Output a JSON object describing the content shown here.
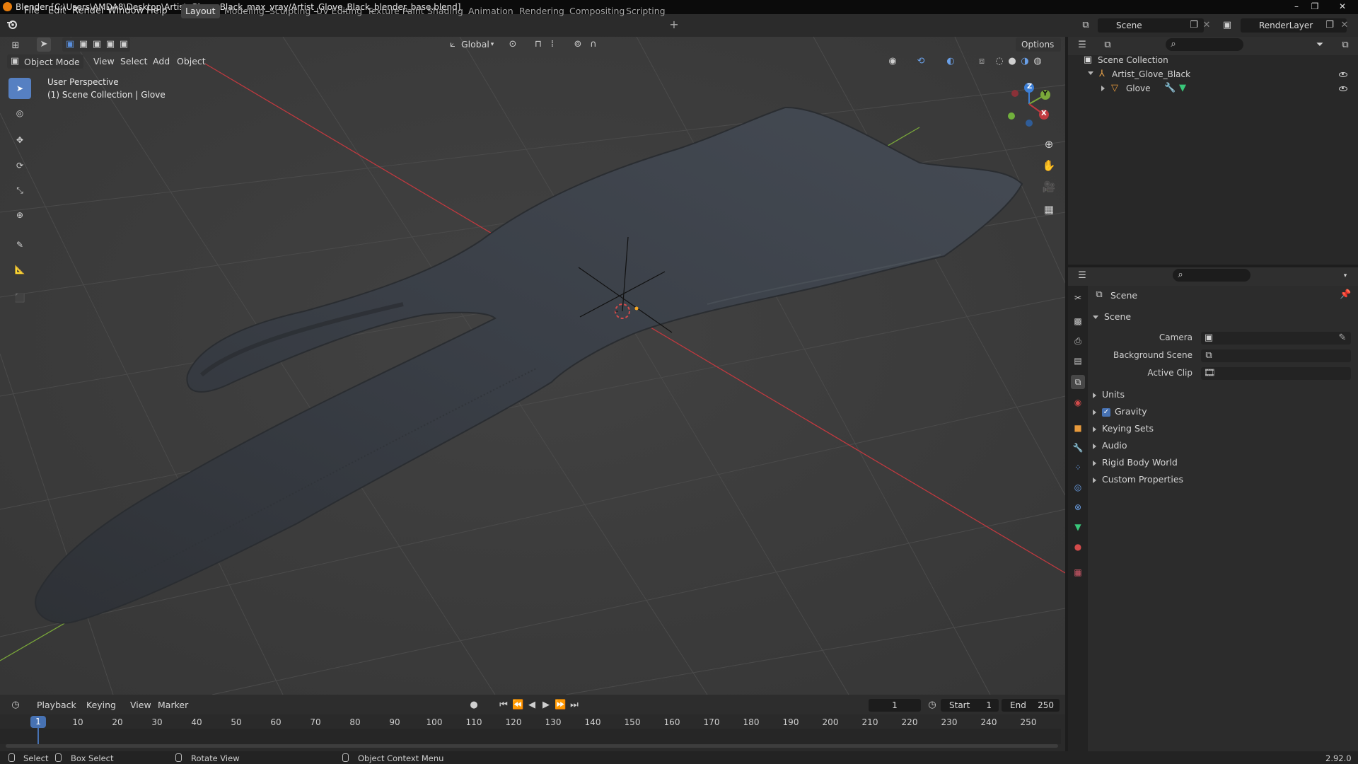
{
  "window": {
    "title": "Blender [C:\\Users\\AMDA8\\Desktop\\Artist_Glove_Black_max_vray/Artist_Glove_Black_blender_base.blend]",
    "controls": [
      "–",
      "❐",
      "✕"
    ]
  },
  "menubar": [
    "File",
    "Edit",
    "Render",
    "Window",
    "Help"
  ],
  "workspaces": [
    "Layout",
    "Modeling",
    "Sculpting",
    "UV Editing",
    "Texture Paint",
    "Shading",
    "Animation",
    "Rendering",
    "Compositing",
    "Scripting"
  ],
  "active_workspace": "Layout",
  "scene_selector": {
    "value": "Scene"
  },
  "viewlayer_selector": {
    "value": "RenderLayer"
  },
  "viewport_header": {
    "transform_orientation": "Global",
    "options_label": "Options",
    "mode": "Object Mode",
    "menus": [
      "View",
      "Select",
      "Add",
      "Object"
    ]
  },
  "viewport": {
    "perspective_label": "User Perspective",
    "collection_label": "(1) Scene Collection | Glove",
    "gizmo_axes": {
      "x": "X",
      "y": "Y",
      "z": "Z"
    },
    "colors": {
      "x_axis": "#c0393f",
      "y_axis": "#7aa83a",
      "z_axis": "#3d7fd6",
      "background": "#3c3c3c",
      "grid": "#4a4a4a"
    }
  },
  "toolbar_tools": [
    "select-box-icon",
    "cursor-icon",
    "move-icon",
    "rotate-icon",
    "scale-icon",
    "transform-icon",
    "annotate-icon",
    "measure-icon",
    "add-cube-icon"
  ],
  "outliner": {
    "root": "Scene Collection",
    "items": [
      {
        "label": "Artist_Glove_Black",
        "level": 1
      },
      {
        "label": "Glove",
        "level": 2
      }
    ]
  },
  "properties": {
    "breadcrumb": "Scene",
    "panel_title": "Scene",
    "fields": [
      {
        "label": "Camera",
        "value": ""
      },
      {
        "label": "Background Scene",
        "value": ""
      },
      {
        "label": "Active Clip",
        "value": ""
      }
    ],
    "subpanels": [
      "Units",
      "Gravity",
      "Keying Sets",
      "Audio",
      "Rigid Body World",
      "Custom Properties"
    ],
    "gravity_checked": true
  },
  "timeline": {
    "menus": [
      "Playback",
      "Keying",
      "View",
      "Marker"
    ],
    "current_frame": "1",
    "start_label": "Start",
    "start_value": "1",
    "end_label": "End",
    "end_value": "250",
    "ruler": [
      "10",
      "20",
      "30",
      "40",
      "50",
      "60",
      "70",
      "80",
      "90",
      "100",
      "110",
      "120",
      "130",
      "140",
      "150",
      "160",
      "170",
      "180",
      "190",
      "200",
      "210",
      "220",
      "230",
      "240",
      "250"
    ],
    "playhead": "1"
  },
  "statusbar": {
    "select": "Select",
    "box_select": "Box Select",
    "rotate_view": "Rotate View",
    "context_menu": "Object Context Menu",
    "version": "2.92.0"
  }
}
